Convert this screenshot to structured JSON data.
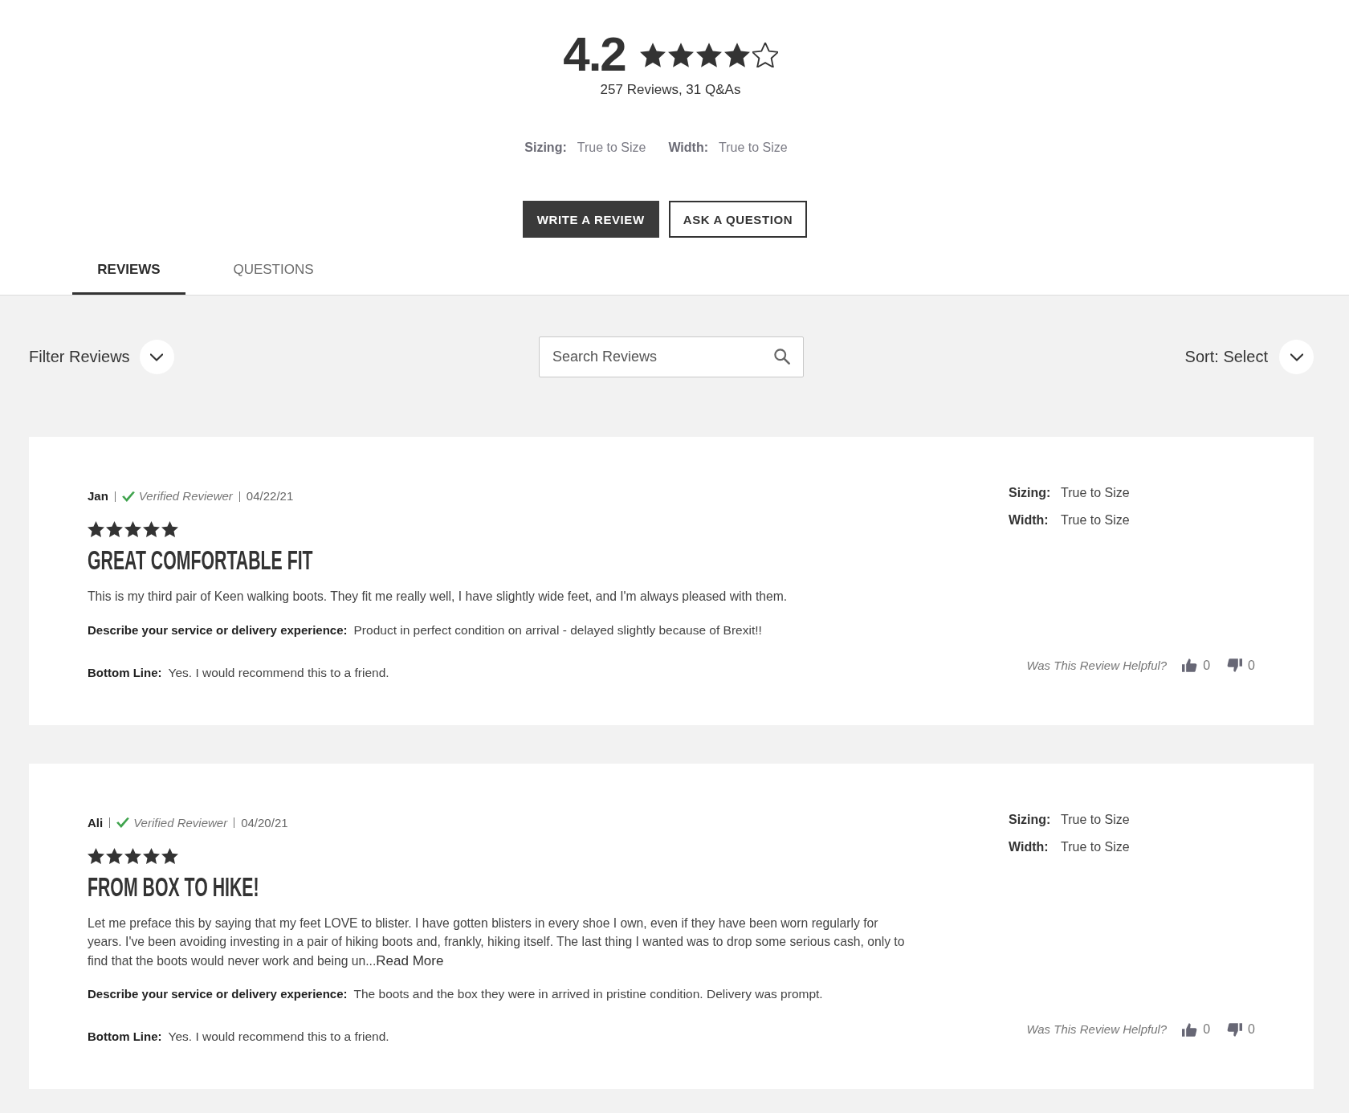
{
  "rating_summary": {
    "rating": "4.2",
    "stars": 4,
    "counts": "257 Reviews, 31 Q&As",
    "fit": [
      {
        "label": "Sizing:",
        "value": "True to Size"
      },
      {
        "label": "Width:",
        "value": "True to Size"
      }
    ]
  },
  "actions": [
    {
      "label": "WRITE A REVIEW",
      "kind": "primary"
    },
    {
      "label": "ASK A QUESTION",
      "kind": "secondary"
    }
  ],
  "tabs": [
    {
      "label": "REVIEWS",
      "selected": true
    },
    {
      "label": "QUESTIONS",
      "selected": false
    }
  ],
  "toolbar": {
    "filter": {
      "label": "Filter Reviews"
    },
    "search": {
      "placeholder": "Search Reviews"
    },
    "sort": {
      "label": "Sort: Select"
    }
  },
  "reviews": [
    {
      "author": "Jan",
      "verified": true,
      "verified_label": "Verified Reviewer",
      "date": "04/22/21",
      "stars": 5,
      "title": "GREAT COMFORTABLE FIT",
      "body": "This is my third pair of Keen walking boots. They fit me really well, I have slightly wide feet, and I'm always pleased with them.",
      "details": [
        {
          "label": "Describe your service or delivery experience:",
          "value": "Product in perfect condition on arrival - delayed slightly because of Brexit!!"
        },
        {
          "label": "Bottom Line:",
          "value": "Yes. I would recommend this to a friend."
        }
      ],
      "fit": [
        {
          "label": "Sizing:",
          "value": "True to Size"
        },
        {
          "label": "Width:",
          "value": "True to Size"
        }
      ],
      "helpful": {
        "prompt": "Was This Review Helpful?",
        "yes": "0",
        "no": "0"
      }
    },
    {
      "author": "Ali",
      "verified": true,
      "verified_label": "Verified Reviewer",
      "date": "04/20/21",
      "stars": 5,
      "title": "FROM BOX TO HIKE!",
      "body": "Let me preface this by saying that my feet LOVE to blister. I have gotten blisters in every shoe I own, even if they have been worn regularly for years. I've been avoiding investing in a pair of hiking boots and, frankly, hiking itself. The last thing I wanted was to drop some serious cash, only to find that the boots would never work and being un...",
      "read_more": "Read More",
      "details": [
        {
          "label": "Describe your service or delivery experience:",
          "value": "The boots and the box they were in arrived in pristine condition. Delivery was prompt."
        },
        {
          "label": "Bottom Line:",
          "value": "Yes. I would recommend this to a friend."
        }
      ],
      "fit": [
        {
          "label": "Sizing:",
          "value": "True to Size"
        },
        {
          "label": "Width:",
          "value": "True to Size"
        }
      ],
      "helpful": {
        "prompt": "Was This Review Helpful?",
        "yes": "0",
        "no": "0"
      }
    }
  ]
}
